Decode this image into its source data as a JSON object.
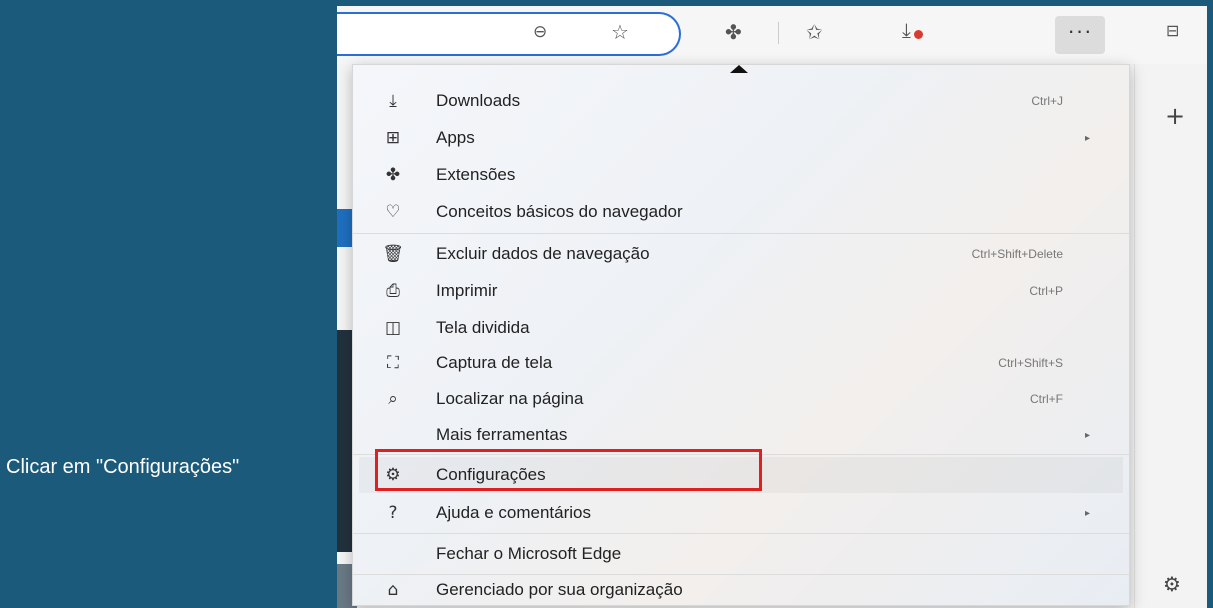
{
  "tutorial": {
    "caption": "Clicar em \"Configurações\""
  },
  "toolbar": {
    "zoom_icon": "zoom-icon",
    "favorite_icon": "star-icon",
    "extensions_icon": "puzzle-icon",
    "favorites_icon": "favorites-icon",
    "downloads_icon": "downloads-icon",
    "more_label": "···",
    "sidebar_toggle_icon": "sidebar-toggle-icon"
  },
  "menu": {
    "items": [
      {
        "label": "Downloads",
        "shortcut": "Ctrl+J",
        "icon": "download-icon"
      },
      {
        "label": "Apps",
        "shortcut": "",
        "icon": "apps-icon",
        "submenu": "▸"
      },
      {
        "label": "Extensões",
        "shortcut": "",
        "icon": "extensions-icon"
      },
      {
        "label": "Conceitos básicos do navegador",
        "shortcut": "",
        "icon": "heart-shield-icon"
      },
      {
        "label": "Excluir dados de navegação",
        "shortcut": "Ctrl+Shift+Delete",
        "icon": "trash-icon"
      },
      {
        "label": "Imprimir",
        "shortcut": "Ctrl+P",
        "icon": "printer-icon"
      },
      {
        "label": "Tela dividida",
        "shortcut": "",
        "icon": "split-screen-icon"
      },
      {
        "label": "Captura de tela",
        "shortcut": "Ctrl+Shift+S",
        "icon": "screenshot-icon"
      },
      {
        "label": "Localizar na página",
        "shortcut": "Ctrl+F",
        "icon": "find-icon"
      },
      {
        "label": "Mais ferramentas",
        "shortcut": "",
        "icon": "",
        "submenu": "▸"
      },
      {
        "label": "Configurações",
        "shortcut": "",
        "icon": "gear-icon"
      },
      {
        "label": "Ajuda e comentários",
        "shortcut": "",
        "icon": "help-icon",
        "submenu": "▸"
      },
      {
        "label": "Fechar o Microsoft Edge",
        "shortcut": "",
        "icon": ""
      },
      {
        "label": "Gerenciado por sua organização",
        "shortcut": "",
        "icon": "briefcase-icon"
      }
    ]
  },
  "sidebar": {
    "add_label": "+",
    "settings_icon": "gear-icon"
  },
  "colors": {
    "highlight_border": "#e02020",
    "frame_bg": "#1b5a7a",
    "address_border": "#2b6ed6"
  }
}
